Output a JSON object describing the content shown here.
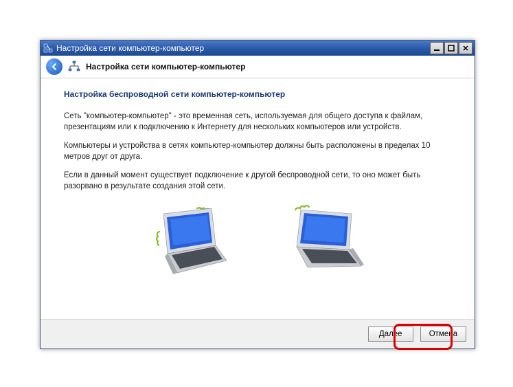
{
  "window": {
    "title": "Настройка сети компьютер-компьютер"
  },
  "nav": {
    "title": "Настройка сети компьютер-компьютер"
  },
  "page": {
    "heading": "Настройка беспроводной сети компьютер-компьютер",
    "p1": "Сеть \"компьютер-компьютер\" - это временная сеть, используемая для общего доступа к файлам, презентациям или к подключению к Интернету для нескольких компьютеров или устройств.",
    "p2": "Компьютеры и устройства в сетях компьютер-компьютер должны быть расположены в пределах 10 метров друг от друга.",
    "p3": "Если в данный момент существует подключение к другой беспроводной сети, то оно может быть разорвано в результате создания этой сети."
  },
  "buttons": {
    "next": "Далее",
    "cancel": "Отмена"
  }
}
